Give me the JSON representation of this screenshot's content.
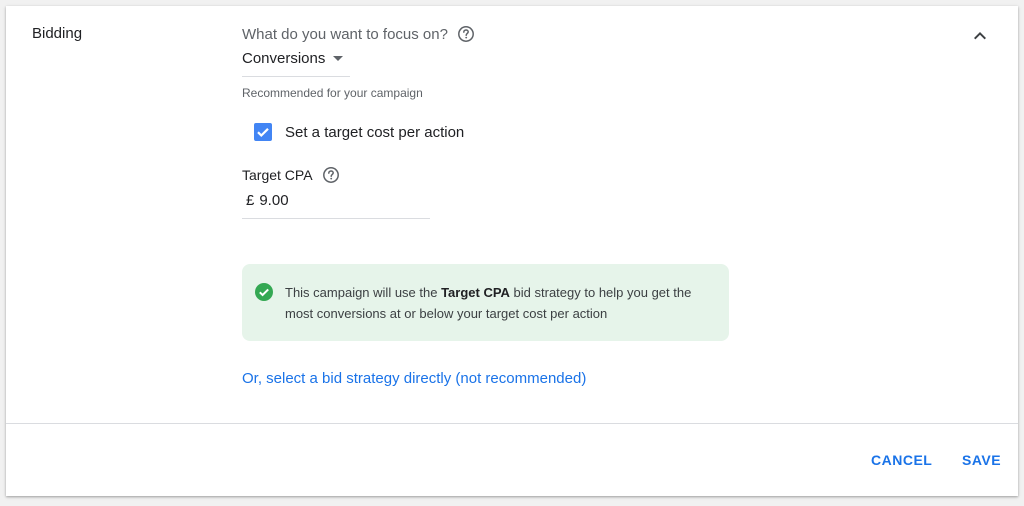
{
  "section": {
    "title": "Bidding"
  },
  "focus": {
    "question": "What do you want to focus on?",
    "selected": "Conversions",
    "recommended_note": "Recommended for your campaign"
  },
  "target_cost_checkbox": {
    "label": "Set a target cost per action",
    "checked": true
  },
  "target_cpa": {
    "label": "Target CPA",
    "currency": "£",
    "value": "9.00"
  },
  "info": {
    "text_before": "This campaign will use the ",
    "text_bold": "Target CPA",
    "text_after": " bid strategy to help you get the most conversions at or below your target cost per action"
  },
  "link": {
    "strategy_text": "Or, select a bid strategy directly (not recommended)"
  },
  "actions": {
    "cancel_label": "CANCEL",
    "save_label": "SAVE"
  },
  "colors": {
    "accent": "#1a73e8",
    "checkbox": "#4285f4",
    "info_background": "#e6f4ea",
    "success": "#34a853"
  },
  "icons": {
    "collapse": "chevron-up-icon",
    "help": "help-circle-icon",
    "dropdown": "caret-down-icon",
    "check": "checkmark-icon",
    "success": "check-circle-icon"
  }
}
